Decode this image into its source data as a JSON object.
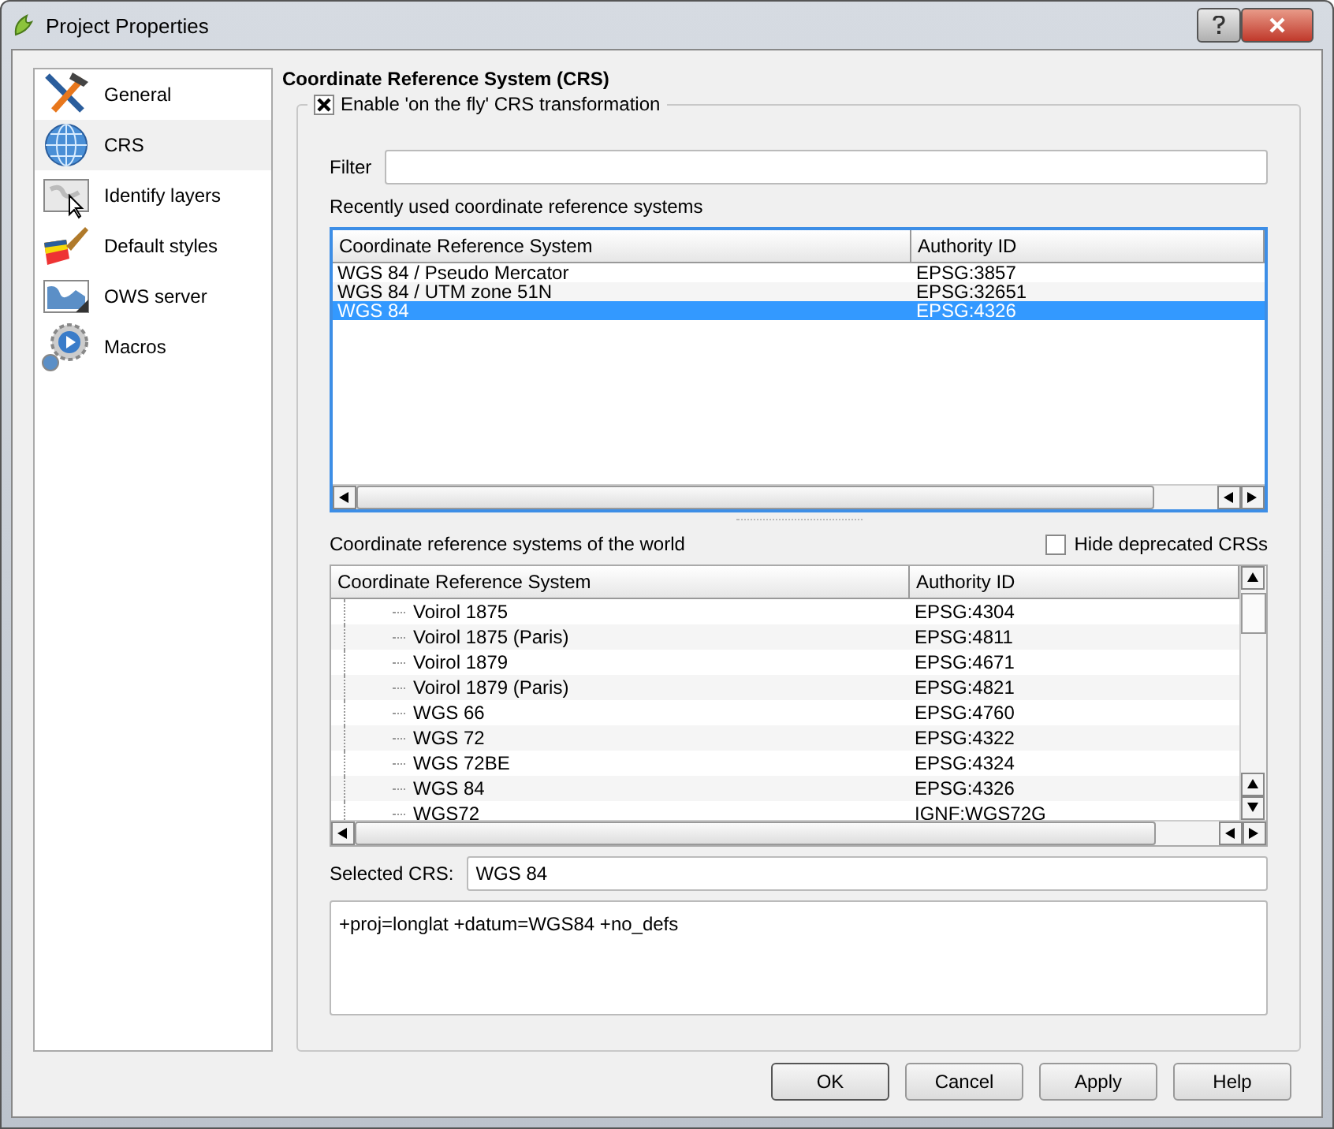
{
  "window": {
    "title": "Project Properties"
  },
  "sidebar": {
    "items": [
      {
        "label": "General",
        "kind": "tools",
        "selected": false
      },
      {
        "label": "CRS",
        "kind": "globe",
        "selected": true
      },
      {
        "label": "Identify layers",
        "kind": "mapcursor",
        "selected": false
      },
      {
        "label": "Default styles",
        "kind": "brush",
        "selected": false
      },
      {
        "label": "OWS server",
        "kind": "map",
        "selected": false
      },
      {
        "label": "Macros",
        "kind": "gears",
        "selected": false
      }
    ]
  },
  "heading": "Coordinate Reference System (CRS)",
  "otf_checkbox": {
    "label": "Enable 'on the fly' CRS transformation",
    "checked": true
  },
  "filter": {
    "label": "Filter"
  },
  "recent_label": "Recently used coordinate reference systems",
  "recent_table": {
    "columns": [
      "Coordinate Reference System",
      "Authority ID"
    ],
    "rows": [
      {
        "name": "WGS 84 / Pseudo Mercator",
        "id": "EPSG:3857",
        "selected": false
      },
      {
        "name": "WGS 84 / UTM zone 51N",
        "id": "EPSG:32651",
        "selected": false
      },
      {
        "name": "WGS 84",
        "id": "EPSG:4326",
        "selected": true
      }
    ]
  },
  "world_label": "Coordinate reference systems of the world",
  "hide_deprecated": {
    "label": "Hide deprecated CRSs",
    "checked": false
  },
  "world_table": {
    "columns": [
      "Coordinate Reference System",
      "Authority ID"
    ],
    "rows": [
      {
        "name": "Voirol 1875",
        "id": "EPSG:4304",
        "selected": false
      },
      {
        "name": "Voirol 1875 (Paris)",
        "id": "EPSG:4811",
        "selected": false
      },
      {
        "name": "Voirol 1879",
        "id": "EPSG:4671",
        "selected": false
      },
      {
        "name": "Voirol 1879 (Paris)",
        "id": "EPSG:4821",
        "selected": false
      },
      {
        "name": "WGS 66",
        "id": "EPSG:4760",
        "selected": false
      },
      {
        "name": "WGS 72",
        "id": "EPSG:4322",
        "selected": false
      },
      {
        "name": "WGS 72BE",
        "id": "EPSG:4324",
        "selected": false
      },
      {
        "name": "WGS 84",
        "id": "EPSG:4326",
        "selected": false
      },
      {
        "name": "WGS72",
        "id": "IGNF:WGS72G",
        "selected": false
      }
    ]
  },
  "selected_crs": {
    "label": "Selected CRS:",
    "value": "WGS 84"
  },
  "proj_string": "+proj=longlat +datum=WGS84 +no_defs",
  "buttons": [
    {
      "label": "OK",
      "default": true
    },
    {
      "label": "Cancel",
      "default": false
    },
    {
      "label": "Apply",
      "default": false
    },
    {
      "label": "Help",
      "default": false
    }
  ]
}
